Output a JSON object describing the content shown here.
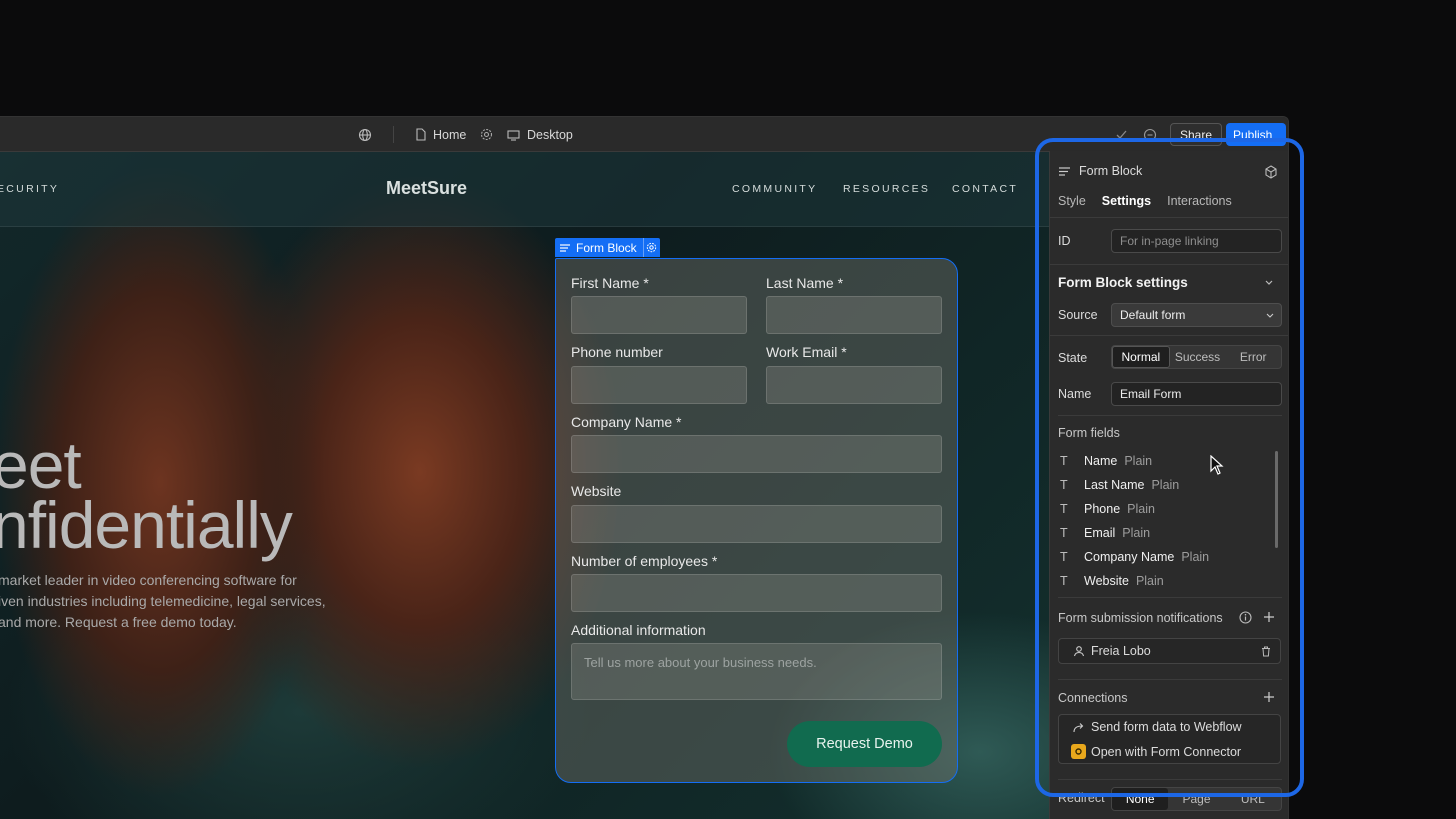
{
  "topbar": {
    "page_label": "Home",
    "breakpoint_label": "Desktop",
    "share_label": "Share",
    "publish_label": "Publish"
  },
  "site": {
    "nav_left": "ECURITY",
    "brand": "MeetSure",
    "nav_links": [
      "COMMUNITY",
      "RESOURCES",
      "CONTACT"
    ],
    "hero_line1": "eet",
    "hero_line2": "nfidentially",
    "hero_text_1": "market leader in video conferencing software for",
    "hero_text_2": "iven industries including telemedicine, legal services,",
    "hero_text_3": "and more. Request a free demo today."
  },
  "form": {
    "tag_label": "Form Block",
    "fields": {
      "first_name": "First Name *",
      "last_name": "Last Name  *",
      "phone": "Phone number",
      "work_email": "Work Email *",
      "company": "Company Name *",
      "website": "Website",
      "employees": "Number of employees *",
      "additional": "Additional information"
    },
    "textarea_placeholder": "Tell us more about your business needs.",
    "submit_label": "Request Demo"
  },
  "panel": {
    "title": "Form Block",
    "tabs": [
      "Style",
      "Settings",
      "Interactions"
    ],
    "active_tab": "Settings",
    "id_label": "ID",
    "id_placeholder": "For in-page linking",
    "settings_title": "Form Block settings",
    "source_label": "Source",
    "source_value": "Default form",
    "state_label": "State",
    "states": [
      "Normal",
      "Success",
      "Error"
    ],
    "name_label": "Name",
    "name_value": "Email Form",
    "form_fields_label": "Form fields",
    "form_fields": [
      {
        "name": "Name",
        "kind": "Plain"
      },
      {
        "name": "Last Name",
        "kind": "Plain"
      },
      {
        "name": "Phone",
        "kind": "Plain"
      },
      {
        "name": "Email",
        "kind": "Plain"
      },
      {
        "name": "Company Name",
        "kind": "Plain"
      },
      {
        "name": "Website",
        "kind": "Plain"
      }
    ],
    "notifications_label": "Form submission notifications",
    "notify_user": "Freia Lobo",
    "connections_label": "Connections",
    "connection_1": "Send form data to Webflow",
    "connection_2": "Open with Form Connector",
    "redirect_label": "Redirect",
    "redirect_options": [
      "None",
      "Page",
      "URL"
    ]
  },
  "colors": {
    "accent": "#146ef5",
    "highlight": "#1d67e6",
    "submit": "#116b4f"
  }
}
